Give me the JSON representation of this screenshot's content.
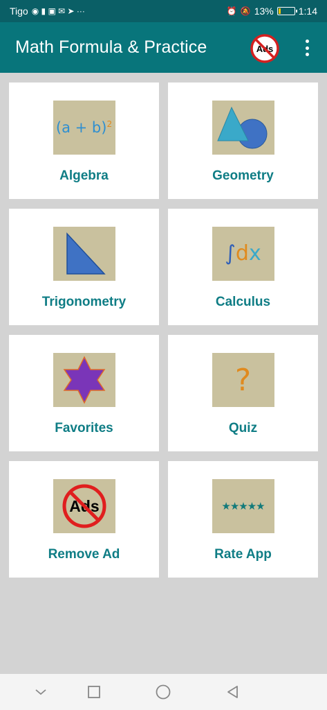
{
  "status_bar": {
    "carrier": "Tigo",
    "notification_glyphs": "◉ ▮ ▣ ✉ ➤ ···",
    "battery_percent": "13%",
    "battery_level": 0.13,
    "time": "1:14"
  },
  "app_bar": {
    "title": "Math Formula & Practice",
    "ads_badge_text": "Ads"
  },
  "tiles": [
    {
      "label": "Algebra",
      "icon": "algebra-icon",
      "icon_text": "(a + b)",
      "icon_superscript": "2"
    },
    {
      "label": "Geometry",
      "icon": "geometry-icon"
    },
    {
      "label": "Trigonometry",
      "icon": "trigonometry-icon"
    },
    {
      "label": "Calculus",
      "icon": "calculus-icon",
      "icon_text_integral": "∫",
      "icon_text_d": "d",
      "icon_text_x": "x"
    },
    {
      "label": "Favorites",
      "icon": "favorites-star-icon"
    },
    {
      "label": "Quiz",
      "icon": "quiz-question-icon",
      "icon_text": "?"
    },
    {
      "label": "Remove Ad",
      "icon": "remove-ad-icon",
      "icon_text": "Ads"
    },
    {
      "label": "Rate App",
      "icon": "rate-app-stars-icon",
      "icon_text": "★★★★★"
    }
  ],
  "colors": {
    "status_bar": "#0a5f66",
    "app_bar": "#08757b",
    "label_teal": "#0f7d85",
    "icon_background": "#c9c19e",
    "page_background": "#d3d3d3"
  }
}
